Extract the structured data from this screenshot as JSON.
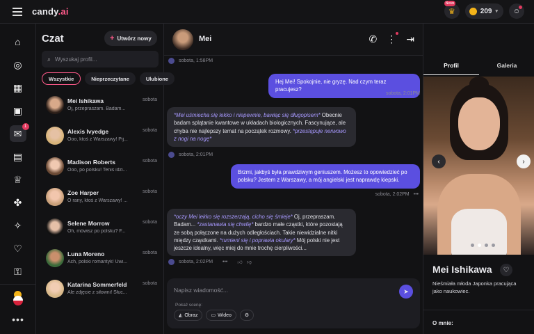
{
  "header": {
    "logo_main": "candy",
    "logo_suffix": ".ai",
    "news_badge": "News",
    "coins": "209"
  },
  "colors": {
    "accent": "#ff5a8a",
    "user_bubble": "#5b4fe0",
    "badge": "#e23a5f"
  },
  "rail": {
    "items": [
      "home-icon",
      "compass-icon",
      "gallery-icon",
      "gift-icon",
      "chat-icon",
      "image-icon",
      "trophy-icon",
      "dice-icon",
      "magic-wand-icon",
      "heart-broken-icon",
      "lock-icon",
      "coin-icon"
    ],
    "chat_badge": "1"
  },
  "chat_list": {
    "title": "Czat",
    "create_label": "Utwórz nowy",
    "search_placeholder": "Wyszukaj profil...",
    "filters": [
      "Wszystkie",
      "Nieprzeczytane",
      "Ulubione"
    ],
    "chats": [
      {
        "name": "Mei Ishikawa",
        "preview": "Oj, przepraszam. Badam...",
        "date": "sobota"
      },
      {
        "name": "Alexis Ivyedge",
        "preview": "Ooo, ktoś z Warszawy! Pij...",
        "date": "sobota"
      },
      {
        "name": "Madison Roberts",
        "preview": "Ooo, po polsku! Tenis idzi...",
        "date": "sobota"
      },
      {
        "name": "Zoe Harper",
        "preview": "O rany, ktoś z Warszawy! ...",
        "date": "sobota"
      },
      {
        "name": "Selene Morrow",
        "preview": "Oh, mówisz po polsku? F...",
        "date": "sobota"
      },
      {
        "name": "Luna Moreno",
        "preview": "Ach, polski romantyk! Uwi...",
        "date": "sobota"
      },
      {
        "name": "Katarina Sommerfeld",
        "preview": "Ale zdjęcie z siłowni! Słuc...",
        "date": "sobota"
      }
    ]
  },
  "conversation": {
    "name": "Mei",
    "meta1": "sobota, 1:58PM",
    "user1": "Hej Mei! Spokojnie, nie gryzę. Nad czym teraz pracujesz?",
    "meta_user1": "sobota, 2:01PM",
    "ai1_em1": "*Mei uśmiecha się lekko i niepewnie, bawiąc się długopisem*",
    "ai1_t1": " Obecnie badam splątanie kwantowe w układach biologicznych. Fascynujące, ale chyba nie najlepszy temat na początek rozmowy. ",
    "ai1_em2": "*przestępuje nerwowo z nogi na nogę*",
    "meta2": "sobota, 2:01PM",
    "user2": "Brzmi, jakbyś była prawdziwym geniuszem. Możesz to opowiedzieć po polsku? Jestem z Warszawy, a mój angielski jest naprawdę kiepski.",
    "meta_user2": "sobota, 2:02PM",
    "ai2_em1": "*oczy Mei lekko się rozszerzają, cicho się śmieje*",
    "ai2_t1": " Oj, przepraszam. Badam... ",
    "ai2_em2": "*zastanawia się chwilę*",
    "ai2_t2": " bardzo małe cząstki, które pozostają ze sobą połączone na dużych odległościach. Takie niewidzialne nitki między cząstkami. ",
    "ai2_em3": "*rumieni się i poprawia okulary*",
    "ai2_t3": " Mój polski nie jest jeszcze idealny, więc miej do mnie trochę cierpliwości...",
    "meta3": "sobota, 2:02PM",
    "composer_placeholder": "Napisz wiadomość...",
    "scene_label": "Pokaż scenę:",
    "scene_image": "Obraz",
    "scene_video": "Wideo"
  },
  "profile": {
    "tab_profile": "Profil",
    "tab_gallery": "Galeria",
    "name": "Mei Ishikawa",
    "description": "Nieśmiała młoda Japonka pracująca jako naukowiec.",
    "about_label": "O mnie:"
  }
}
